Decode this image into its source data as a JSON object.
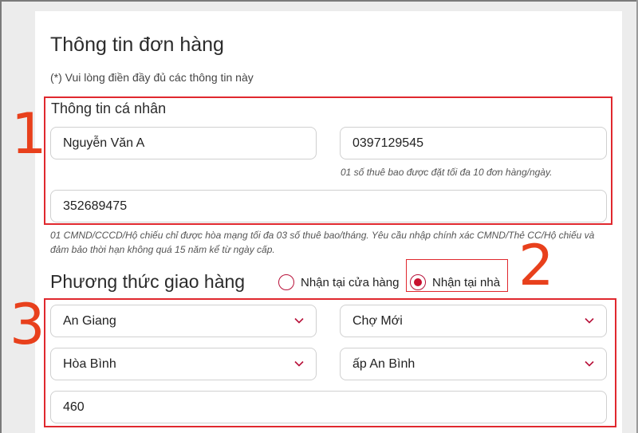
{
  "form": {
    "title": "Thông tin đơn hàng",
    "note": "(*) Vui lòng điền đầy đủ các thông tin này",
    "personal": {
      "heading": "Thông tin cá nhân",
      "name_value": "Nguyễn Văn A",
      "phone_value": "0397129545",
      "phone_hint": "01 số thuê bao được đặt tối đa 10 đơn hàng/ngày.",
      "id_value": "352689475",
      "id_hint": "01 CMND/CCCD/Hộ chiếu chỉ được hòa mạng tối đa 03 số thuê bao/tháng. Yêu cầu nhập chính xác CMND/Thẻ CC/Hộ chiếu và đảm bảo thời hạn không quá 15 năm kể từ ngày cấp."
    },
    "delivery": {
      "heading": "Phương thức giao hàng",
      "option_store": "Nhận tại cửa hàng",
      "option_home": "Nhận tại nhà",
      "selected": "Nhận tại nhà",
      "province": "An Giang",
      "district": "Chợ Mới",
      "ward": "Hòa Bình",
      "hamlet": "ấp An Bình",
      "address": "460"
    }
  },
  "annotations": {
    "n1": "1",
    "n2": "2",
    "n3": "3"
  },
  "colors": {
    "annotation_red": "#e0282e",
    "number_orange": "#e8401c",
    "radio_accent": "#c8102e"
  },
  "icons": {
    "select_arrow": "chevron-down-icon"
  }
}
